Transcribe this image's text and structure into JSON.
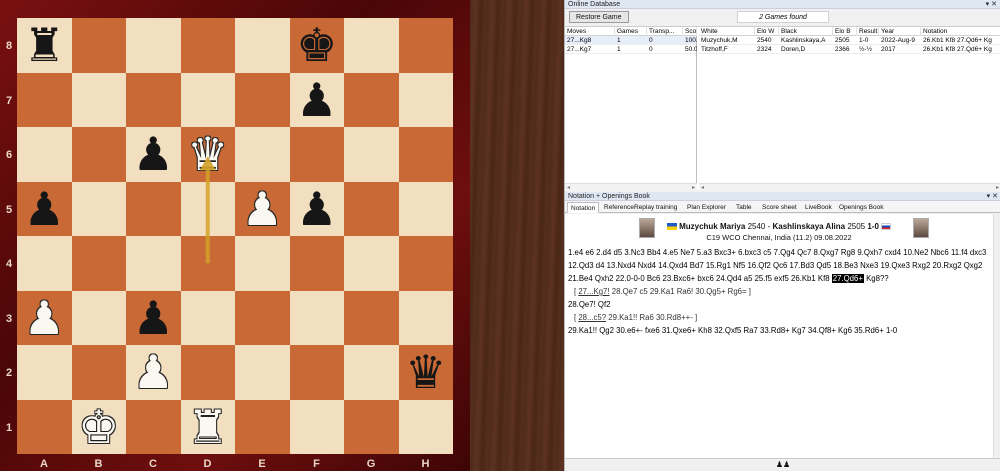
{
  "board": {
    "ranks": [
      "8",
      "7",
      "6",
      "5",
      "4",
      "3",
      "2",
      "1"
    ],
    "files": [
      "A",
      "B",
      "C",
      "D",
      "E",
      "F",
      "G",
      "H"
    ],
    "pieces": [
      {
        "sq": "a8",
        "piece": "rook",
        "color": "black",
        "glyph": "♜"
      },
      {
        "sq": "f8",
        "piece": "king",
        "color": "black",
        "glyph": "♚"
      },
      {
        "sq": "f7",
        "piece": "pawn",
        "color": "black",
        "glyph": "♟"
      },
      {
        "sq": "c6",
        "piece": "pawn",
        "color": "black",
        "glyph": "♟"
      },
      {
        "sq": "d6",
        "piece": "queen",
        "color": "white",
        "glyph": "♛"
      },
      {
        "sq": "a5",
        "piece": "pawn",
        "color": "black",
        "glyph": "♟"
      },
      {
        "sq": "e5",
        "piece": "pawn",
        "color": "white",
        "glyph": "♟"
      },
      {
        "sq": "f5",
        "piece": "pawn",
        "color": "black",
        "glyph": "♟"
      },
      {
        "sq": "a3",
        "piece": "pawn",
        "color": "white",
        "glyph": "♟"
      },
      {
        "sq": "c3",
        "piece": "pawn",
        "color": "black",
        "glyph": "♟"
      },
      {
        "sq": "c2",
        "piece": "pawn",
        "color": "white",
        "glyph": "♟"
      },
      {
        "sq": "h2",
        "piece": "queen",
        "color": "black",
        "glyph": "♛"
      },
      {
        "sq": "b1",
        "piece": "king",
        "color": "white",
        "glyph": "♚"
      },
      {
        "sq": "d1",
        "piece": "rook",
        "color": "white",
        "glyph": "♜"
      }
    ],
    "last_move_arrow": {
      "from": "d4",
      "to": "d6",
      "color": "#d3a227"
    },
    "colors": {
      "light": "#f1dfbf",
      "dark": "#c96a36"
    }
  },
  "online_db": {
    "title": "Online Database",
    "controls": "▾ ✕",
    "restore_label": "Restore Game",
    "games_found": "2 Games found",
    "moves_headers": [
      "Moves",
      "Games",
      "Transp...",
      "Scor"
    ],
    "moves_rows": [
      [
        "27...Kg8",
        "1",
        "0",
        "100."
      ],
      [
        "27...Kg7",
        "1",
        "0",
        "50.0"
      ]
    ],
    "games_headers": [
      "White",
      "Elo W",
      "Black",
      "Elo B",
      "Result",
      "Year",
      "Notation"
    ],
    "games_rows": [
      [
        "Muzychuk,M",
        "2540",
        "Kashlinskaya,A",
        "2505",
        "1-0",
        "2022-Aug-9",
        "26.Kb1 Kf8 27.Qd6+ Kg"
      ],
      [
        "Titzhoff,F",
        "2324",
        "Doren,D",
        "2366",
        "½-½",
        "2017",
        "26.Kb1 Kf8 27.Qd6+ Kg"
      ]
    ]
  },
  "notation": {
    "title": "Notation + Openings Book",
    "controls": "▾ ✕",
    "tabs": [
      "Notation",
      "Reference",
      "Replay training",
      "Plan Explorer",
      "Table",
      "Score sheet",
      "LiveBook",
      "Openings Book"
    ],
    "white": "Muzychuk Mariya",
    "white_elo": "2540",
    "black": "Kashlinskaya Alina",
    "black_elo": "2505",
    "result": "1-0",
    "event_line": "C19  WCO Chennai, India (11.2) 09.08.2022",
    "main_before": "1.e4  e6  2.d4  d5  3.Nc3  Bb4  4.e5  Ne7  5.a3  Bxc3+  6.bxc3  c5  7.Qg4  Qc7  8.Qxg7  Rg8  9.Qxh7  cxd4  10.Ne2  Nbc6  11.f4  dxc3  12.Qd3  d4  13.Nxd4  Nxd4  14.Qxd4  Bd7  15.Rg1  Nf5  16.Qf2  Qc6  17.Bd3  Qd5  18.Be3  Nxe3  19.Qxe3  Rxg2  20.Rxg2  Qxg2  21.Be4  Qxh2  22.0-0-0  Bc6  23.Bxc6+  bxc6  24.Qd4  a5  25.f5  exf5  26.Kb1  Kf8",
    "current_move": "27.Qd6+",
    "main_after": "Kg8??",
    "var1_a": "27...Kg7!",
    "var1_b": "28.Qe7  c5  29.Ka1  Ra6!  30.Qg5+  Rg6=",
    "line2": "28.Qe7!  Qf2",
    "var2_a": "28...c5?",
    "var2_b": "29.Ka1!!  Ra6  30.Rd8++-",
    "main_end": "29.Ka1!!  Qg2  30.e6+-  fxe6  31.Qxe6+  Kh8  32.Qxf5  Ra7  33.Rd8+  Kg7  34.Qf8+  Kg6  35.Rd6+  1-0"
  },
  "status": {
    "glyph": "♟♟"
  }
}
